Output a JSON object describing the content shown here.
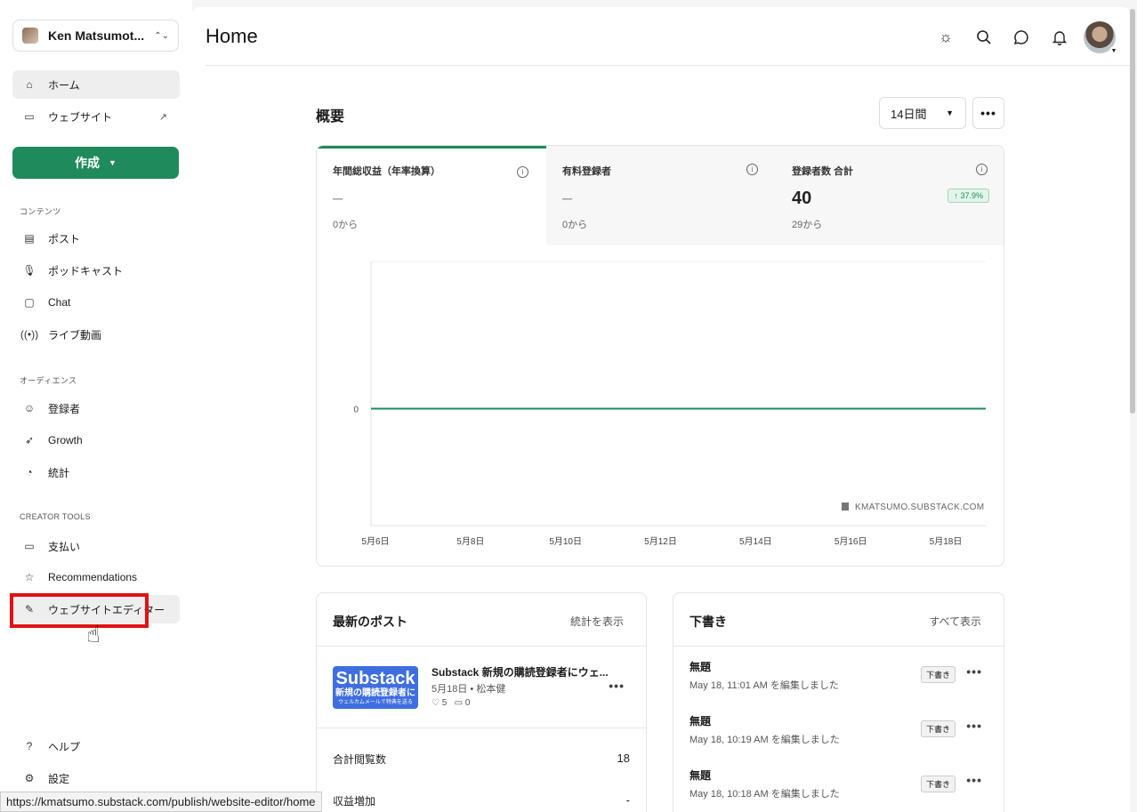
{
  "account": {
    "name": "Ken Matsumot..."
  },
  "nav": {
    "home": "ホーム",
    "website": "ウェブサイト",
    "create": "作成",
    "content_label": "コンテンツ",
    "posts": "ポスト",
    "podcast": "ポッドキャスト",
    "chat": "Chat",
    "live": "ライブ動画",
    "audience_label": "オーディエンス",
    "subscribers": "登録者",
    "growth": "Growth",
    "stats": "統計",
    "tools_label": "CREATOR TOOLS",
    "payments": "支払い",
    "recommendations": "Recommendations",
    "website_editor": "ウェブサイトエディター",
    "help": "ヘルプ",
    "settings": "設定"
  },
  "header": {
    "title": "Home"
  },
  "overview": {
    "title": "概要",
    "period": "14日間",
    "stats": [
      {
        "label": "年間総収益（年率換算）",
        "value": "–",
        "from": "0から"
      },
      {
        "label": "有料登録者",
        "value": "–",
        "from": "0から"
      },
      {
        "label": "登録者数 合計",
        "value": "40",
        "from": "29から",
        "change": "37.9%"
      }
    ]
  },
  "chart_data": {
    "type": "line",
    "x": [
      "5月6日",
      "5月8日",
      "5月10日",
      "5月12日",
      "5月14日",
      "5月16日",
      "5月18日"
    ],
    "series": [
      {
        "values": [
          0,
          0,
          0,
          0,
          0,
          0,
          0
        ]
      }
    ],
    "y_ticks": [
      "0"
    ],
    "watermark": "KMATSUMO.SUBSTACK.COM",
    "line_color": "#1f8a5b"
  },
  "latest_posts": {
    "title": "最新のポスト",
    "link": "統計を表示",
    "post": {
      "title": "Substack 新規の購読登録者にウェ...",
      "meta": "5月18日 • 松本健",
      "likes": "5",
      "comments": "0",
      "thumb_line1": "Substack",
      "thumb_line2": "新規の購読登録者に",
      "thumb_line3": "ウェルカムメールで特典を送る"
    },
    "rows": [
      {
        "label": "合計閲覧数",
        "value": "18"
      },
      {
        "label": "収益増加",
        "value": "-"
      }
    ]
  },
  "drafts": {
    "title": "下書き",
    "link": "すべて表示",
    "items": [
      {
        "title": "無題",
        "meta": "May 18, 11:01 AM を編集しました",
        "badge": "下書き"
      },
      {
        "title": "無題",
        "meta": "May 18, 10:19 AM を編集しました",
        "badge": "下書き"
      },
      {
        "title": "無題",
        "meta": "May 18, 10:18 AM を編集しました",
        "badge": "下書き"
      }
    ]
  },
  "status_url": "https://kmatsumo.substack.com/publish/website-editor/home"
}
